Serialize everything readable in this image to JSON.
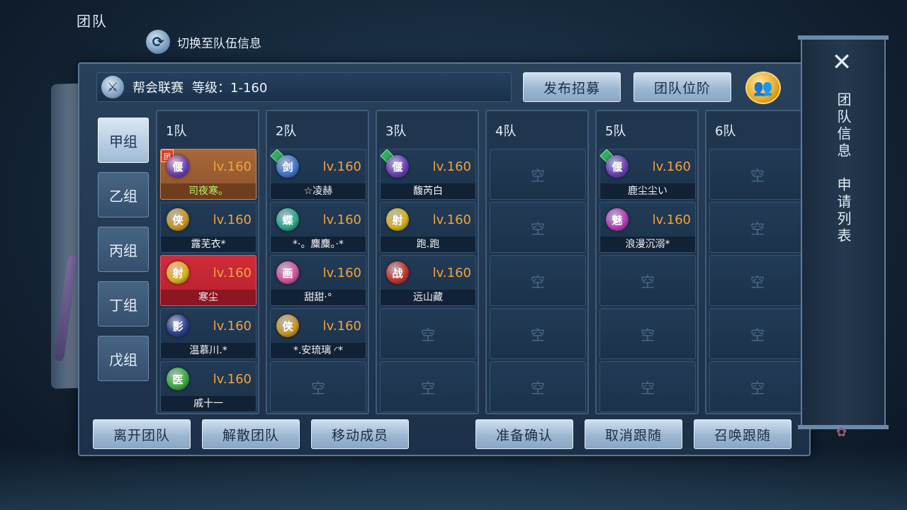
{
  "top": {
    "title": "团队",
    "switch_label": "切换至队伍信息",
    "switch_icon": "refresh-icon"
  },
  "header": {
    "league_name": "帮会联赛",
    "level_label": "等级：1-160",
    "recruit_label": "发布招募",
    "rank_label": "团队位阶",
    "add_icon": "add-member-icon"
  },
  "groups": [
    {
      "label": "甲组",
      "active": true
    },
    {
      "label": "乙组",
      "active": false
    },
    {
      "label": "丙组",
      "active": false
    },
    {
      "label": "丁组",
      "active": false
    },
    {
      "label": "戊组",
      "active": false
    }
  ],
  "teams": [
    {
      "title": "1队",
      "members": [
        {
          "name": "司夜寒。",
          "level": "lv.160",
          "icon": "偃",
          "icon_color": "#6a3fb7",
          "leader": true,
          "leader_badge": "团"
        },
        {
          "name": "露芜衣*",
          "level": "lv.160",
          "icon": "侠",
          "icon_color": "#c99424"
        },
        {
          "name": "寒尘",
          "level": "lv.160",
          "icon": "射",
          "icon_color": "#d6b11a",
          "highlight": true
        },
        {
          "name": "温慕川.*",
          "level": "lv.160",
          "icon": "影",
          "icon_color": "#2b3f8f"
        },
        {
          "name": "戚十一",
          "level": "lv.160",
          "icon": "医",
          "icon_color": "#3caa3c"
        }
      ]
    },
    {
      "title": "2队",
      "members": [
        {
          "name": "☆凌赫",
          "level": "lv.160",
          "icon": "剑",
          "icon_color": "#3f75c9",
          "gem": true
        },
        {
          "name": "*·。麋麋。·*",
          "level": "lv.160",
          "icon": "蝶",
          "icon_color": "#2aa888"
        },
        {
          "name": "甜甜·°",
          "level": "lv.160",
          "icon": "画",
          "icon_color": "#d3539a"
        },
        {
          "name": "*.安琉璃 ◜*",
          "level": "lv.160",
          "icon": "侠",
          "icon_color": "#c99424"
        }
      ]
    },
    {
      "title": "3队",
      "members": [
        {
          "name": "馥芮白",
          "level": "lv.160",
          "icon": "偃",
          "icon_color": "#6a3fb7",
          "gem": true
        },
        {
          "name": "跑.跑",
          "level": "lv.160",
          "icon": "射",
          "icon_color": "#d6b11a"
        },
        {
          "name": "远山藏",
          "level": "lv.160",
          "icon": "战",
          "icon_color": "#c4342c"
        }
      ]
    },
    {
      "title": "4队",
      "members": []
    },
    {
      "title": "5队",
      "members": [
        {
          "name": "鹿尘尘い",
          "level": "lv.160",
          "icon": "偃",
          "icon_color": "#6a3fb7",
          "gem": true
        },
        {
          "name": "浪漫沉溺*",
          "level": "lv.160",
          "icon": "魅",
          "icon_color": "#b33fb8"
        }
      ]
    },
    {
      "title": "6队",
      "members": []
    }
  ],
  "empty_label": "空",
  "bottom": {
    "leave_label": "离开团队",
    "disband_label": "解散团队",
    "move_label": "移动成员",
    "ready_label": "准备确认",
    "cancel_follow_label": "取消跟随",
    "summon_label": "召唤跟随"
  },
  "side": {
    "close_icon": "close-icon",
    "team_info_label": "团队信息",
    "apply_list_label": "申请列表"
  }
}
